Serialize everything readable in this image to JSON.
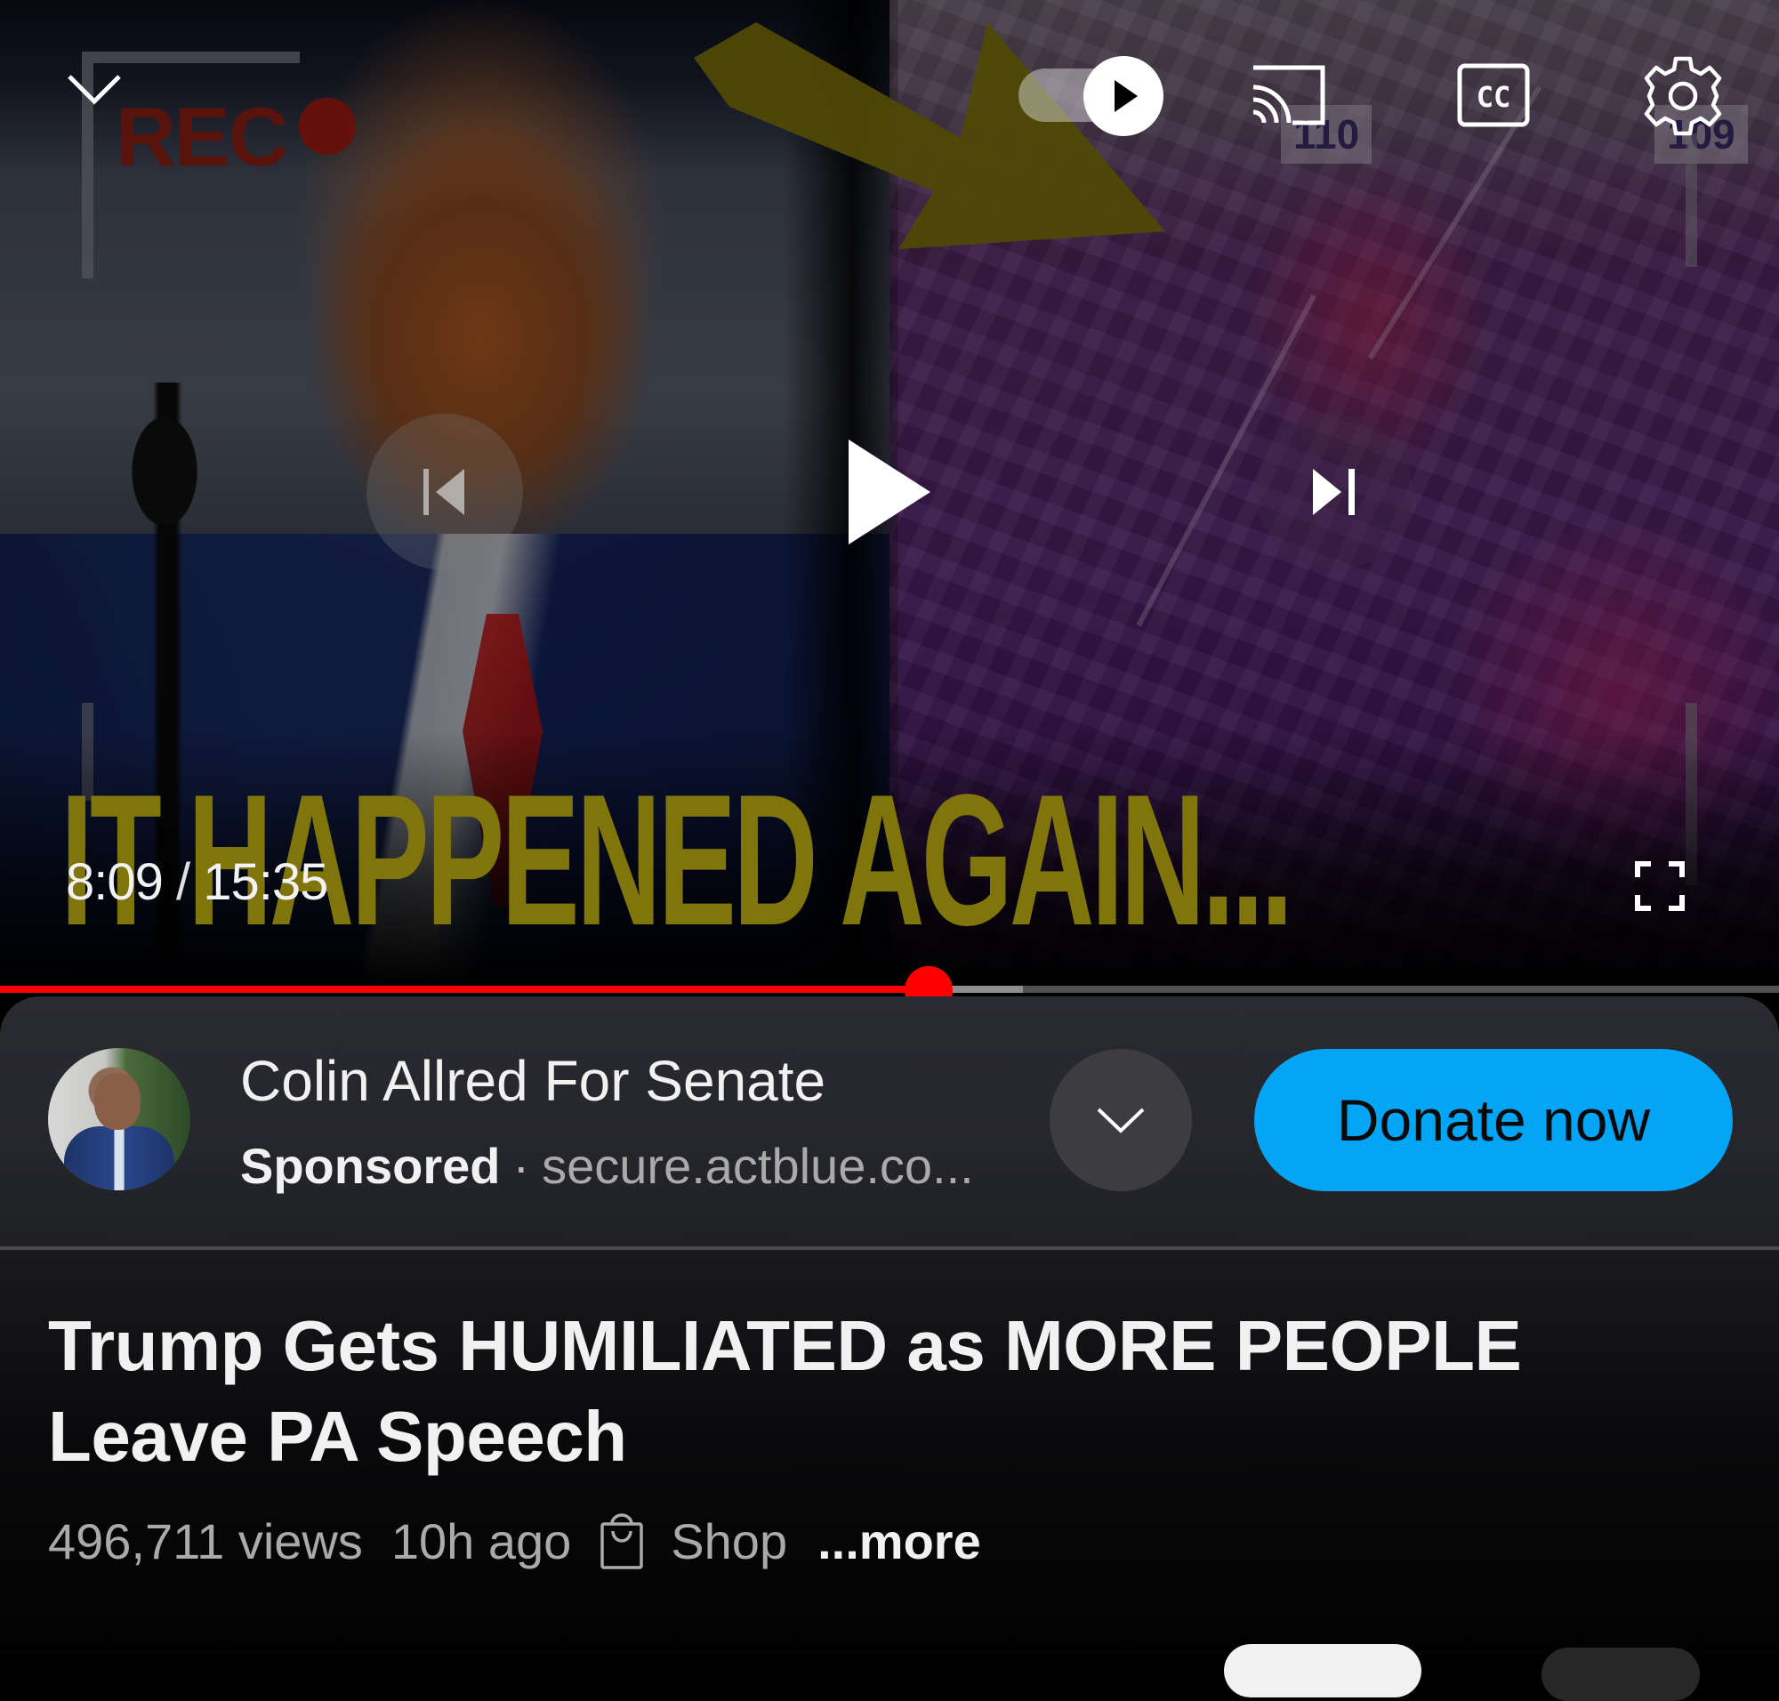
{
  "player": {
    "current_time": "8:09",
    "time_separator": "/",
    "duration": "15:35",
    "progress_fraction": 0.522,
    "buffered_fraction": 0.575,
    "autoplay": "on",
    "thumbnail": {
      "headline": "IT HAPPENED AGAIN...",
      "rec_label": "REC",
      "sign_left": "110",
      "sign_right": "109"
    },
    "icons": {
      "collapse": "chevron-down-icon",
      "autoplay": "autoplay-toggle-icon",
      "cast": "cast-icon",
      "captions": "cc-icon",
      "settings": "gear-icon",
      "previous": "skip-previous-icon",
      "play": "play-icon",
      "next": "skip-next-icon",
      "fullscreen": "fullscreen-icon"
    },
    "captions_label": "CC"
  },
  "ad": {
    "advertiser": "Colin Allred For Senate",
    "sponsored_label": "Sponsored",
    "separator": "·",
    "url": "secure.actblue.co...",
    "cta_label": "Donate now",
    "cta_color": "#05a5f5",
    "expand_icon": "chevron-down-icon"
  },
  "video": {
    "title": "Trump Gets HUMILIATED as MORE PEOPLE Leave PA Speech",
    "views": "496,711 views",
    "age": "10h ago",
    "shop_label": "Shop",
    "more_label": "...more"
  },
  "colors": {
    "progress_played": "#ff0000",
    "background": "#000000",
    "text_primary": "#f1f1f1",
    "text_secondary": "#aaaaaa"
  }
}
